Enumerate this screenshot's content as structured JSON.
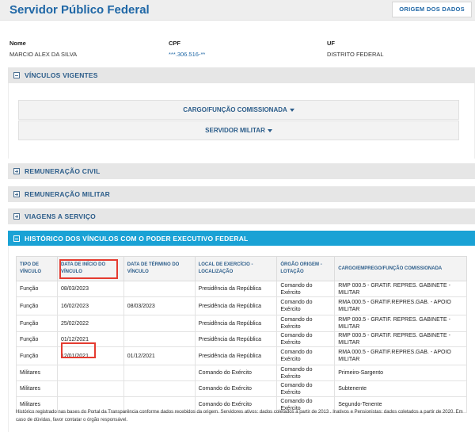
{
  "header": {
    "title": "Servidor Público Federal",
    "origin_button": "ORIGEM DOS DADOS"
  },
  "person": {
    "nome_label": "Nome",
    "nome": "MARCIO ALEX DA SILVA",
    "cpf_label": "CPF",
    "cpf": "***.306.516-**",
    "uf_label": "UF",
    "uf": "DISTRITO FEDERAL"
  },
  "sections": {
    "vinculos": "VÍNCULOS VIGENTES",
    "rem_civil": "REMUNERAÇÃO CIVIL",
    "rem_militar": "REMUNERAÇÃO MILITAR",
    "viagens": "VIAGENS A SERVIÇO",
    "historico": "HISTÓRICO DOS VÍNCULOS COM O PODER EXECUTIVO FEDERAL"
  },
  "vinculos": {
    "cargo_label": "CARGO/FUNÇÃO COMISSIONADA",
    "militar_label": "SERVIDOR MILITAR"
  },
  "table": {
    "headers": [
      "TIPO DE VÍNCULO",
      "DATA DE INÍCIO DO VÍNCULO",
      "DATA DE TÉRMINO DO VÍNCULO",
      "LOCAL DE EXERCÍCIO - LOCALIZAÇÃO",
      "ÓRGÃO ORIGEM - LOTAÇÃO",
      "CARGO/EMPREGO/FUNÇÃO COMISSIONADA"
    ],
    "rows": [
      [
        "Função",
        "08/03/2023",
        "",
        "Presidência da República",
        "Comando do Exército",
        "RMP 000.5 - GRATIF. REPRES. GABINETE - MILITAR"
      ],
      [
        "Função",
        "16/02/2023",
        "08/03/2023",
        "Presidência da República",
        "Comando do Exército",
        "RMA 000.5 - GRATIF.REPRES.GAB. - APOIO MILITAR"
      ],
      [
        "Função",
        "25/02/2022",
        "",
        "Presidência da República",
        "Comando do Exército",
        "RMP 000.5 - GRATIF. REPRES. GABINETE - MILITAR"
      ],
      [
        "Função",
        "01/12/2021",
        "",
        "Presidência da República",
        "Comando do Exército",
        "RMP 000.5 - GRATIF. REPRES. GABINETE - MILITAR"
      ],
      [
        "Função",
        "12/01/2021",
        "01/12/2021",
        "Presidência da República",
        "Comando do Exército",
        "RMA 000.5 - GRATIF.REPRES.GAB. - APOIO MILITAR"
      ],
      [
        "Militares",
        "",
        "",
        "Comando do Exército",
        "Comando do Exército",
        "Primeiro-Sargento"
      ],
      [
        "Militares",
        "",
        "",
        "Comando do Exército",
        "Comando do Exército",
        "Subtenente"
      ],
      [
        "Militares",
        "",
        "",
        "Comando do Exército",
        "Comando do Exército",
        "Segundo-Tenente"
      ]
    ]
  },
  "footnote": "Histórico registrado nas bases do Portal da Transparência conforme dados recebidos da origem. Servidores ativos: dados coletados a partir de 2013 . Inativos e Pensionistas: dados coletados a partir de 2020. Em caso de dúvidas, favor contatar o órgão responsável.",
  "colors": {
    "brand_blue": "#1f67a6",
    "active_section": "#1aa2d5",
    "highlight": "#e53b30"
  }
}
